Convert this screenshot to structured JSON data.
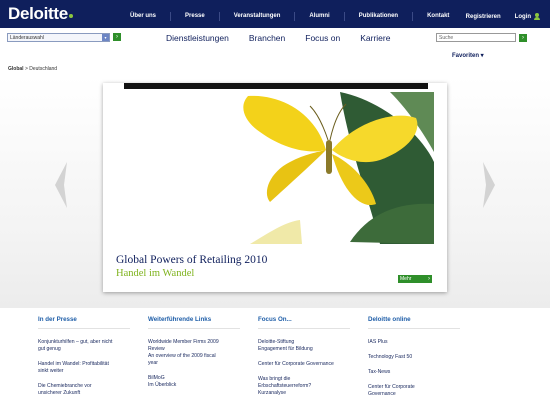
{
  "logo": "Deloitte",
  "colors": {
    "navy": "#0f1f5c",
    "green": "#8cc63f",
    "link_blue": "#1f5ea8",
    "button_green": "#2f8f2a"
  },
  "topnav": [
    "Über uns",
    "Presse",
    "Veranstaltungen",
    "Alumni",
    "Publikationen",
    "Kontakt"
  ],
  "toplinks": {
    "register": "Registrieren",
    "login": "Login"
  },
  "country_select": {
    "value": "Länderauswahl"
  },
  "mainnav": [
    "Dienstleistungen",
    "Branchen",
    "Focus on",
    "Karriere"
  ],
  "search": {
    "placeholder": "Suche"
  },
  "favoriten": "Favoriten ▾",
  "breadcrumb": {
    "root": "Global",
    "current": "> Deutschland"
  },
  "hero": {
    "title": "Global Powers of Retailing 2010",
    "subtitle": "Handel im Wandel",
    "more_button": "Mehr"
  },
  "columns": [
    {
      "heading": "In der Presse",
      "items": [
        [
          "Konjunkturhilfen – gut, aber nicht",
          "gut genug"
        ],
        [
          "Handel im Wandel: Profitabilität",
          "sinkt weiter"
        ],
        [
          "Die Chemiebranche vor",
          "unsicherer Zukunft"
        ]
      ]
    },
    {
      "heading": "Weiterführende Links",
      "items": [
        [
          "Worldwide Member Firms 2009",
          "Review",
          "An overview of the 2009 fiscal",
          "year"
        ],
        [
          "BilMoG",
          "Im Überblick"
        ]
      ]
    },
    {
      "heading": "Focus On...",
      "items": [
        [
          "Deloitte-Stiftung",
          "Engagement für Bildung"
        ],
        [
          "Center für Corporate Governance"
        ],
        [
          "Was bringt die",
          "Erbschaftsteuerreform?",
          "Kurzanalyse"
        ]
      ]
    },
    {
      "heading": "Deloitte online",
      "items": [
        [
          "IAS Plus"
        ],
        [
          "Technology Fast 50"
        ],
        [
          "Tax-News"
        ],
        [
          "Center für Corporate",
          "Governance"
        ]
      ]
    }
  ]
}
